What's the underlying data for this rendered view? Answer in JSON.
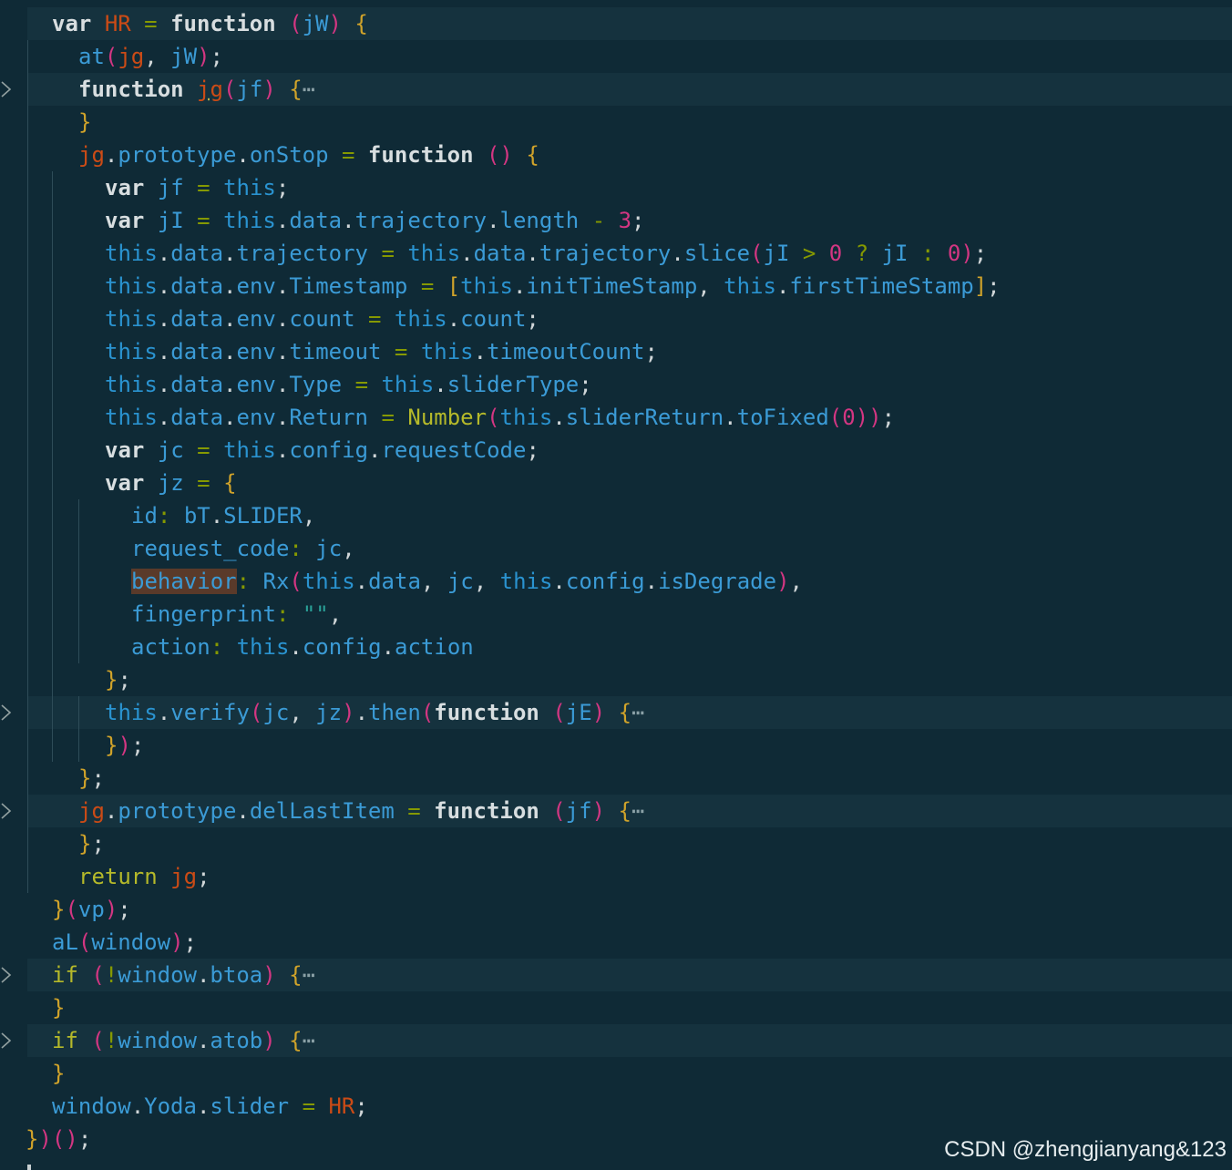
{
  "editor": {
    "lines": [
      "var HR = function (jW) {",
      "at(jg, jW);",
      "function jg(jf) {",
      "}",
      "jg.prototype.onStop = function () {",
      "var jf = this;",
      "var jI = this.data.trajectory.length - 3;",
      "this.data.trajectory = this.data.trajectory.slice(jI > 0 ? jI : 0);",
      "this.data.env.Timestamp = [this.initTimeStamp, this.firstTimeStamp];",
      "this.data.env.count = this.count;",
      "this.data.env.timeout = this.timeoutCount;",
      "this.data.env.Type = this.sliderType;",
      "this.data.env.Return = Number(this.sliderReturn.toFixed(0));",
      "var jc = this.config.requestCode;",
      "var jz = {",
      "id: bT.SLIDER,",
      "request_code: jc,",
      "behavior: Rx(this.data, jc, this.config.isDegrade),",
      "fingerprint: \"\",",
      "action: this.config.action",
      "};",
      "this.verify(jc, jz).then(function (jE) {",
      "});",
      "};",
      "jg.prototype.delLastItem = function (jf) {",
      "};",
      "return jg;",
      "}(vp);",
      "aL(window);",
      "if (!window.btoa) {",
      "}",
      "if (!window.atob) {",
      "}",
      "window.Yoda.slider = HR;",
      "})();"
    ],
    "ellipsis": "⋯"
  },
  "watermark": "CSDN @zhengjianyang&123"
}
